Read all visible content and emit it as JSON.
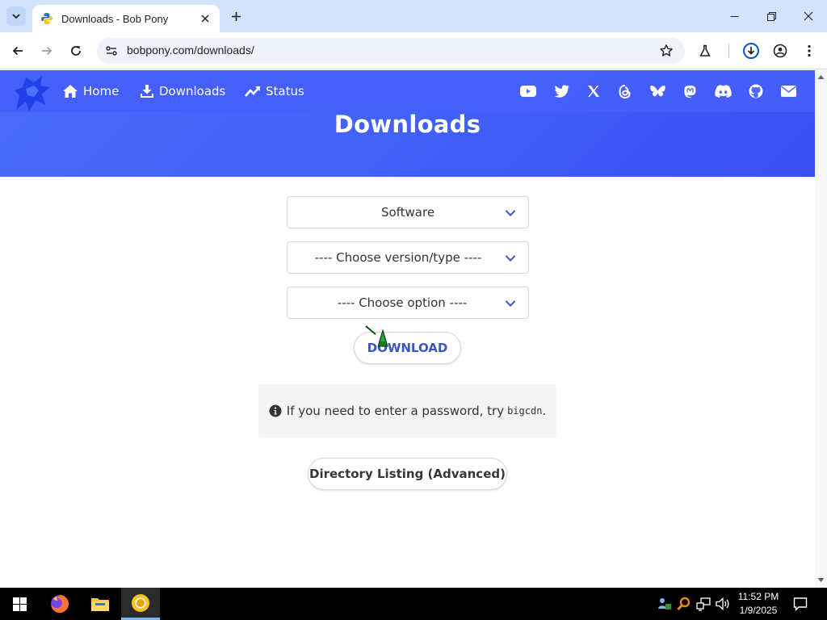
{
  "browser": {
    "tab": {
      "title": "Downloads - Bob Pony",
      "favicon": "python-logo-icon"
    },
    "url": "bobpony.com/downloads/",
    "accent": "#d3e3fd"
  },
  "nav": {
    "items": [
      {
        "label": "Home",
        "icon": "home-icon"
      },
      {
        "label": "Downloads",
        "icon": "download-icon"
      },
      {
        "label": "Status",
        "icon": "trend-icon"
      }
    ],
    "social": [
      "youtube-icon",
      "twitter-icon",
      "x-icon",
      "threads-icon",
      "bluesky-icon",
      "mastodon-icon",
      "discord-icon",
      "github-icon",
      "email-icon"
    ],
    "brand_color": "#4a6cfa"
  },
  "page": {
    "title": "Downloads",
    "selects": [
      {
        "value": "Software"
      },
      {
        "value": "---- Choose version/type ----"
      },
      {
        "value": "---- Choose option ----"
      }
    ],
    "download_button": "DOWNLOAD",
    "notice": {
      "text": "If you need to enter a password, try",
      "code": "bigcdn",
      "suffix": "."
    },
    "directory_button": "Directory Listing (Advanced)"
  },
  "taskbar": {
    "apps": [
      "windows-start-icon",
      "firefox-icon",
      "file-explorer-icon",
      "chrome-icon"
    ],
    "clock": {
      "time": "11:52 PM",
      "date": "1/9/2025"
    }
  }
}
